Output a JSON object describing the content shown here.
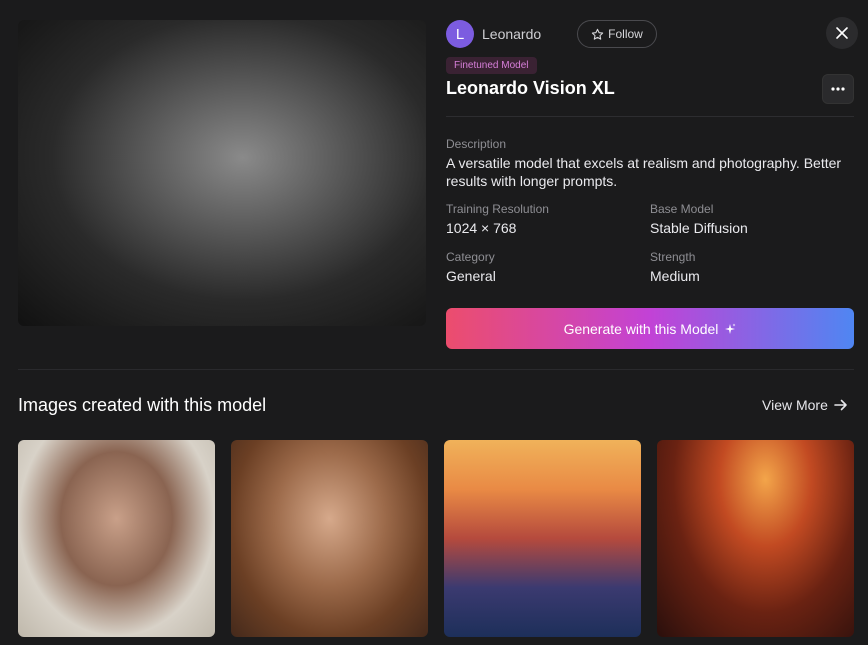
{
  "author": {
    "initial": "L",
    "name": "Leonardo",
    "avatar_color": "#7c5ce0"
  },
  "follow_label": "Follow",
  "badge": "Finetuned Model",
  "model": {
    "title": "Leonardo Vision XL",
    "description_label": "Description",
    "description": "A versatile model that excels at realism and photography. Better results with longer prompts.",
    "meta": [
      {
        "label": "Training Resolution",
        "value": "1024 × 768"
      },
      {
        "label": "Base Model",
        "value": "Stable Diffusion"
      },
      {
        "label": "Category",
        "value": "General"
      },
      {
        "label": "Strength",
        "value": "Medium"
      }
    ]
  },
  "generate_label": "Generate with this Model",
  "section": {
    "title": "Images created with this model",
    "view_more": "View More"
  },
  "icons": {
    "close": "close-icon",
    "star": "star-icon",
    "more": "more-horizontal-icon",
    "sparkle": "sparkle-icon",
    "arrow": "arrow-right-icon"
  },
  "colors": {
    "background": "#1b1b1c",
    "badge_text": "#d77fd9",
    "gradient_start": "#ec4d6d",
    "gradient_mid": "#c242d6",
    "gradient_end": "#4f86f2"
  }
}
